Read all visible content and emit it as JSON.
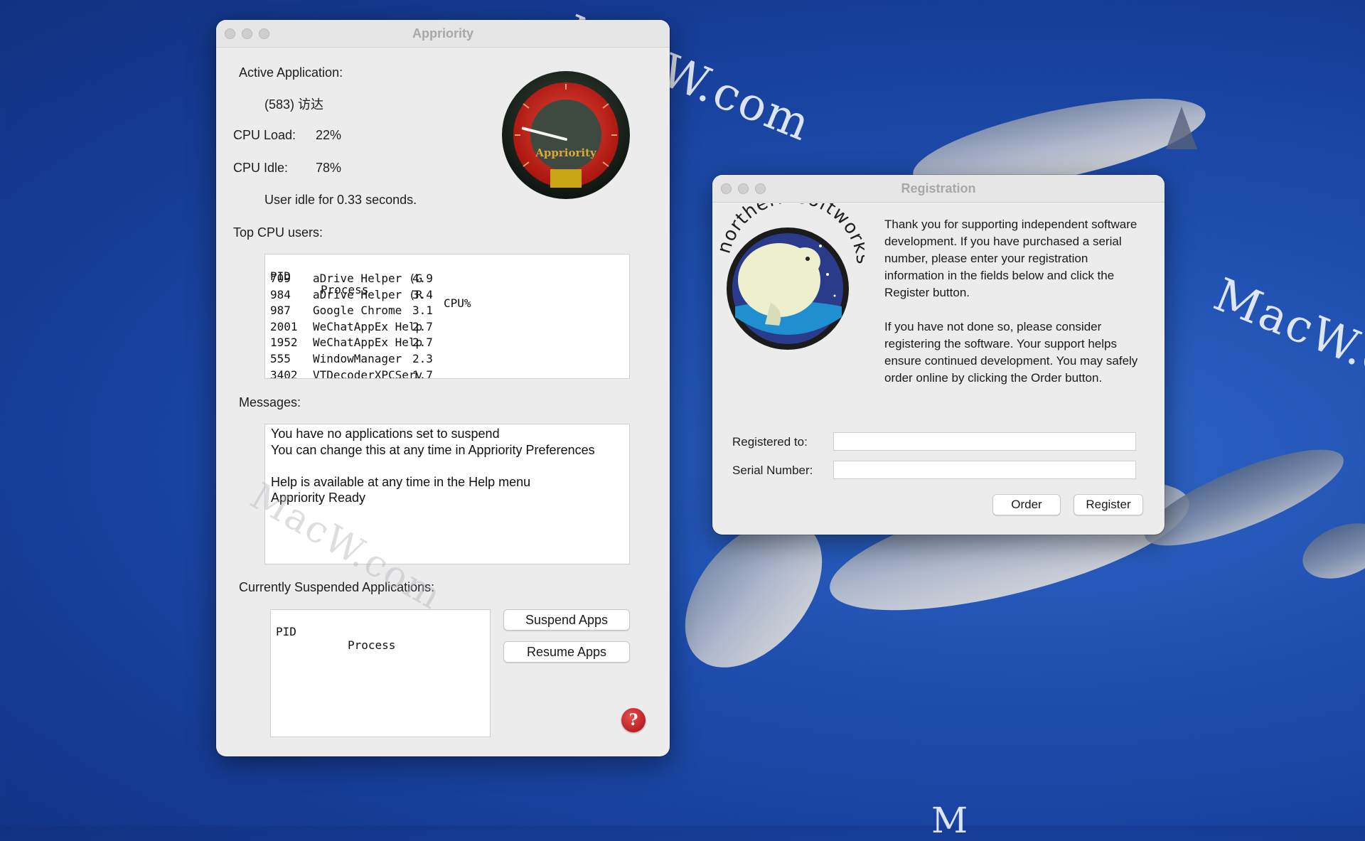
{
  "desktop": {
    "watermarks": [
      "MacW.com",
      "MacW.c",
      "MacW.com",
      "M"
    ]
  },
  "main_window": {
    "title": "Appriority",
    "active_app_label": "Active Application:",
    "active_app_value": "(583)  访达",
    "cpu_load_label": "CPU Load:",
    "cpu_load_value": "22%",
    "cpu_idle_label": "CPU Idle:",
    "cpu_idle_value": "78%",
    "user_idle_text": "User idle for 0.33 seconds.",
    "gauge_label": "Appriority",
    "gauge_level": 0.22,
    "top_cpu_label": "Top CPU users:",
    "top_cpu_headers": [
      "PID",
      "Process",
      "CPU%"
    ],
    "top_cpu_rows": [
      {
        "pid": "709",
        "process": "aDrive Helper (G",
        "cpu": "4.9"
      },
      {
        "pid": "984",
        "process": "aDrive Helper (R",
        "cpu": "3.4"
      },
      {
        "pid": "987",
        "process": "Google Chrome",
        "cpu": "3.1"
      },
      {
        "pid": "2001",
        "process": "WeChatAppEx Help",
        "cpu": "2.7"
      },
      {
        "pid": "1952",
        "process": "WeChatAppEx Help",
        "cpu": "2.7"
      },
      {
        "pid": "555",
        "process": "WindowManager",
        "cpu": "2.3"
      },
      {
        "pid": "3402",
        "process": "VTDecoderXPCServ",
        "cpu": "1.7"
      }
    ],
    "messages_label": "Messages:",
    "messages_lines": [
      "You have no applications set to suspend",
      "You can change this at any time in Appriority Preferences",
      "",
      "Help is available at any time in the Help menu",
      "Appriority Ready"
    ],
    "suspended_label": "Currently Suspended Applications:",
    "suspended_headers": [
      "PID",
      "Process"
    ],
    "suspend_button": "Suspend Apps",
    "resume_button": "Resume Apps",
    "help_glyph": "?"
  },
  "registration_window": {
    "title": "Registration",
    "logo_text": "northern softworks",
    "paragraph1": "Thank you for supporting independent software development.  If you have purchased a serial number, please enter your registration information in the fields below and click the Register button.",
    "paragraph2": "If you have not done so, please consider registering the software.  Your support helps ensure continued development.  You may safely order online by clicking the Order button.",
    "registered_to_label": "Registered to:",
    "registered_to_value": "",
    "serial_label": "Serial Number:",
    "serial_value": "",
    "order_button": "Order",
    "register_button": "Register"
  }
}
